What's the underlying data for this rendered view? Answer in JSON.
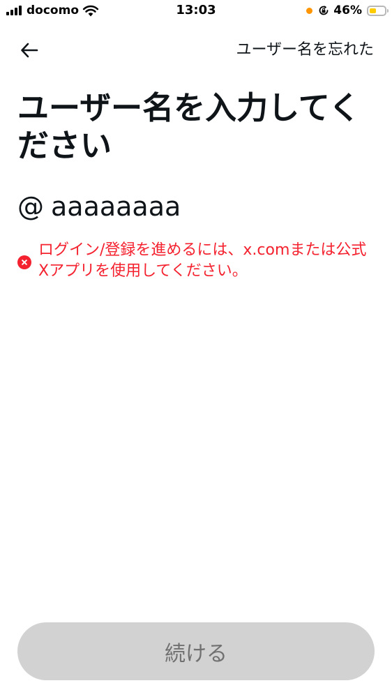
{
  "status_bar": {
    "carrier": "docomo",
    "time": "13:03",
    "battery_percent": "46%",
    "battery_level": 0.46,
    "mic_indicator_color": "#ff9500",
    "battery_fill_color": "#ffcc00"
  },
  "header": {
    "back_icon": "arrow-left-icon",
    "forgot_label": "ユーザー名を忘れた"
  },
  "title": "ユーザー名を入力してください",
  "username": {
    "prefix": "@",
    "value": "aaaaaaaa"
  },
  "error": {
    "icon": "error-x-icon",
    "message": "ログイン/登録を進めるには、x.comまたは公式Xアプリを使用してください。",
    "color": "#f4212e"
  },
  "continue_button": {
    "label": "続ける",
    "disabled": true
  }
}
